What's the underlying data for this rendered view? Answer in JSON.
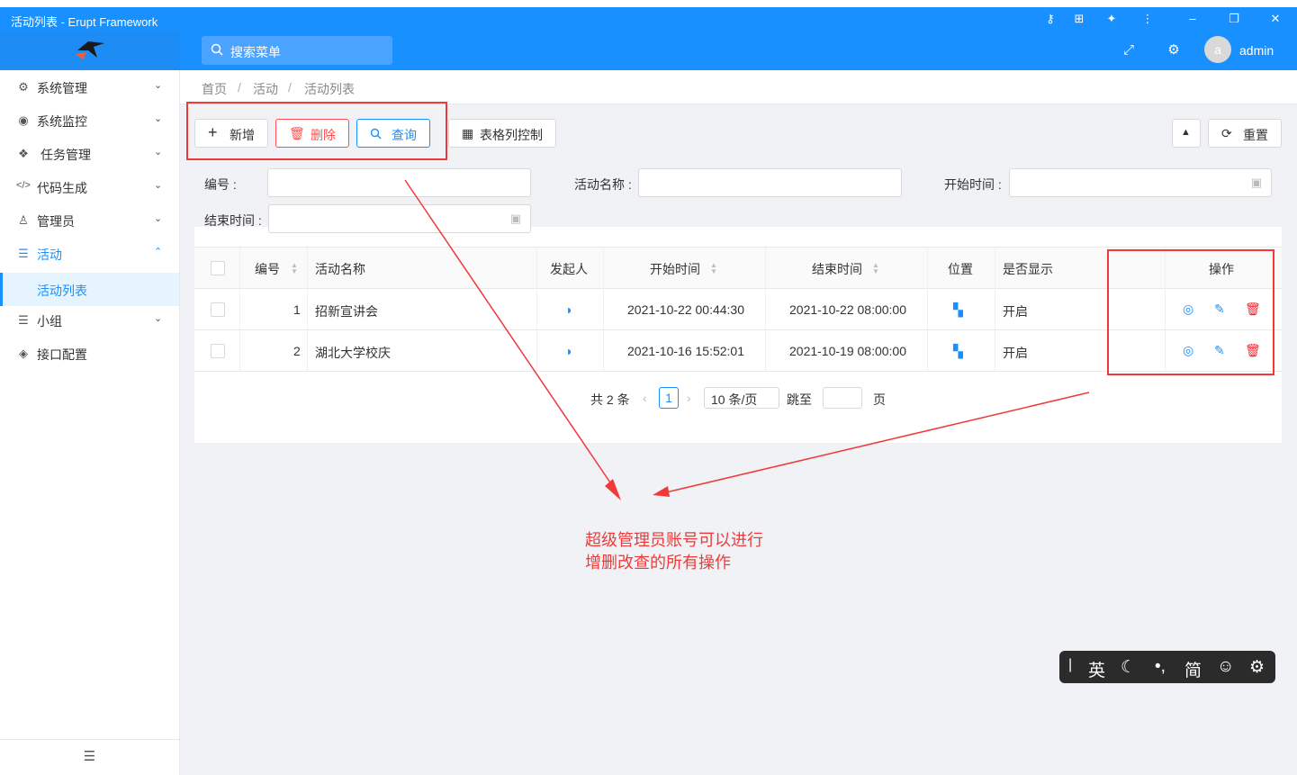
{
  "window": {
    "title": "活动列表 - Erupt Framework",
    "icons": [
      "key-icon",
      "translate-icon",
      "puzzle-icon",
      "more-icon",
      "minimize-icon",
      "restore-icon",
      "close-icon"
    ]
  },
  "header": {
    "search_placeholder": "搜索菜单",
    "username": "admin",
    "avatar_letter": "a"
  },
  "sidebar": {
    "items": [
      {
        "label": "系统管理",
        "icon": "gears-icon"
      },
      {
        "label": "系统监控",
        "icon": "monitor-icon"
      },
      {
        "label": "任务管理",
        "icon": "cubes-icon"
      },
      {
        "label": "代码生成",
        "icon": "code-icon"
      },
      {
        "label": "管理员",
        "icon": "user-tie-icon"
      },
      {
        "label": "活动",
        "icon": "list-icon"
      },
      {
        "label": "活动列表",
        "icon": ""
      },
      {
        "label": "小组",
        "icon": "list-icon"
      },
      {
        "label": "接口配置",
        "icon": "cube-icon"
      }
    ]
  },
  "breadcrumb": {
    "home": "首页",
    "sep": "/",
    "level1": "活动",
    "level2": "活动列表"
  },
  "toolbar": {
    "add": "新增",
    "delete": "删除",
    "query": "查询",
    "columns": "表格列控制",
    "reset": "重置"
  },
  "filters": {
    "id_label": "编号 :",
    "name_label": "活动名称 :",
    "start_label": "开始时间 :",
    "end_label": "结束时间 :"
  },
  "table": {
    "headers": {
      "id": "编号",
      "name": "活动名称",
      "initiator": "发起人",
      "start": "开始时间",
      "end": "结束时间",
      "location": "位置",
      "show": "是否显示",
      "ops": "操作"
    },
    "rows": [
      {
        "id": "1",
        "name": "招新宣讲会",
        "start": "2021-10-22 00:44:30",
        "end": "2021-10-22 08:00:00",
        "show": "开启"
      },
      {
        "id": "2",
        "name": "湖北大学校庆",
        "start": "2021-10-16 15:52:01",
        "end": "2021-10-19 08:00:00",
        "show": "开启"
      }
    ]
  },
  "pagination": {
    "total": "共 2 条",
    "current": "1",
    "page_size": "10 条/页",
    "jump": "跳至",
    "page_unit": "页"
  },
  "annotation": {
    "line1": "超级管理员账号可以进行",
    "line2": "增删改查的所有操作"
  },
  "ime": {
    "lang": "英",
    "script": "简"
  },
  "colors": {
    "primary": "#1890ff",
    "danger": "#ff4d4f",
    "annotation": "#f03a3a"
  }
}
